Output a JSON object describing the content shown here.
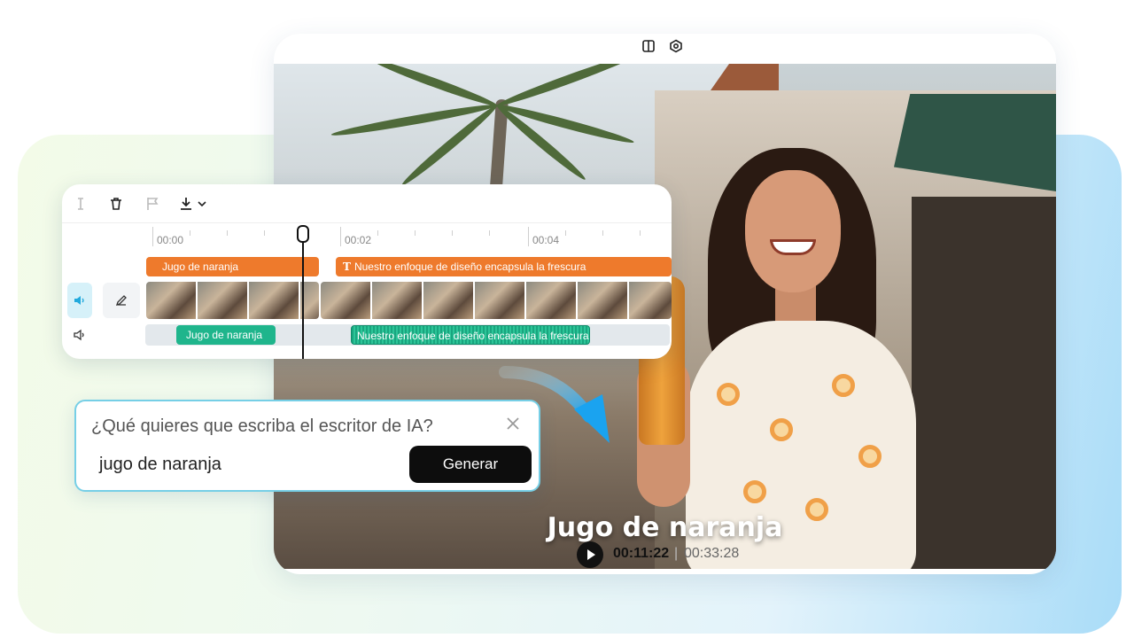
{
  "player": {
    "caption": "Jugo de naranja",
    "current_time": "00:11:22",
    "separator": "|",
    "total_time": "00:33:28",
    "top_icons": [
      "panel-toggle-icon",
      "settings-hex-icon"
    ]
  },
  "timeline": {
    "toolbar_icons": [
      "split-icon",
      "trash-icon",
      "flag-icon",
      "download-icon",
      "chevron-down-icon"
    ],
    "ruler": [
      "00:00",
      "00:02",
      "00:04"
    ],
    "text_clips": [
      {
        "label": "Jugo de naranja"
      },
      {
        "label": "Nuestro enfoque de diseño encapsula la frescura"
      }
    ],
    "audio_clips": [
      {
        "label": "Jugo de naranja"
      },
      {
        "label": "Nuestro enfoque de diseño encapsula la frescura"
      }
    ],
    "side_icons": [
      "volume-icon",
      "edit-pen-icon",
      "speaker-icon"
    ]
  },
  "prompt": {
    "title": "¿Qué quieres que escriba el escritor de IA?",
    "value": "jugo de naranja",
    "button": "Generar"
  },
  "colors": {
    "orange_clip": "#ee7a2c",
    "green_clip": "#1fb58c",
    "accent_border": "#76cfe6",
    "button_bg": "#0d0d0d"
  }
}
